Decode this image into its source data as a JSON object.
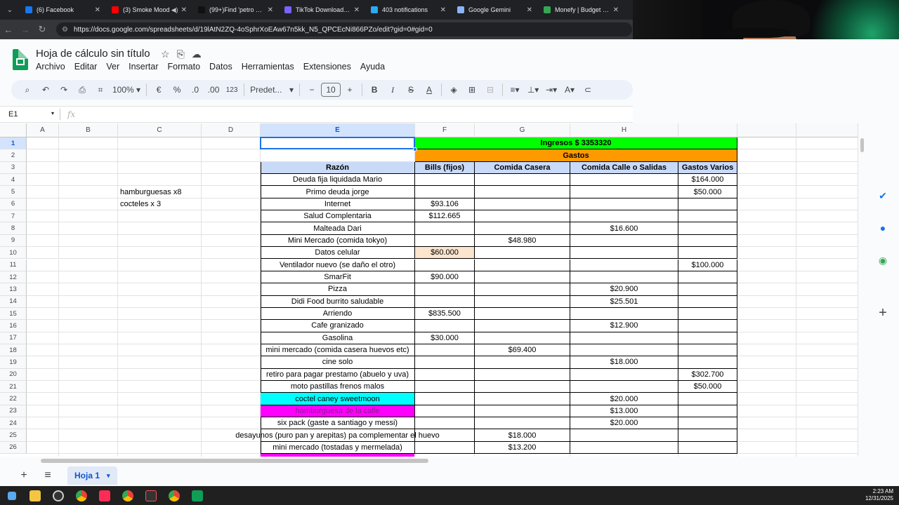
{
  "browser": {
    "tabs": [
      {
        "title": "(6) Facebook",
        "color": "#1877f2",
        "sound": false
      },
      {
        "title": "(3) Smoke Mood",
        "color": "#ff0000",
        "sound": true
      },
      {
        "title": "(99+)Find 'petro anu",
        "color": "#111111",
        "sound": false
      },
      {
        "title": "TikTok Downloader -",
        "color": "#7b61ff",
        "sound": false
      },
      {
        "title": "403 notifications",
        "color": "#2aabee",
        "sound": false
      },
      {
        "title": "Google Gemini",
        "color": "#8ab4f8",
        "sound": false
      },
      {
        "title": "Monefy | Budget & Tr",
        "color": "#34a853",
        "sound": false
      }
    ],
    "url": "https://docs.google.com/spreadsheets/d/19lAtN2ZQ-4oSphrXoEAw67n5kk_N5_QPCEcNi866PZo/edit?gid=0#gid=0"
  },
  "doc": {
    "title": "Hoja de cálculo sin título",
    "menus": [
      "Archivo",
      "Editar",
      "Ver",
      "Insertar",
      "Formato",
      "Datos",
      "Herramientas",
      "Extensiones",
      "Ayuda"
    ]
  },
  "toolbar": {
    "zoom": "100%",
    "currency": "€",
    "percent": "%",
    "dec_less": ".0",
    "dec_more": ".00",
    "number_format": "123",
    "font": "Predet...",
    "font_size": "10"
  },
  "formula_bar": {
    "cell_ref": "E1",
    "fx": "fx"
  },
  "columns": [
    "A",
    "B",
    "C",
    "D",
    "E",
    "F",
    "G",
    "H"
  ],
  "selected_column": "E",
  "selected_row": "1",
  "rows": [
    "1",
    "2",
    "3",
    "4",
    "5",
    "6",
    "7",
    "8",
    "9",
    "10",
    "11",
    "12",
    "13",
    "14",
    "15",
    "16",
    "17",
    "18",
    "19",
    "20",
    "21",
    "22",
    "23",
    "24",
    "25",
    "26"
  ],
  "sheet": {
    "ingresos": "Ingresos $ 3353320",
    "gastos": "Gastos",
    "headers": {
      "E": "Razón",
      "F": "Bills (fijos)",
      "G": "Comida Casera",
      "H": "Comida Calle o Salidas",
      "I": "Gastos Varios"
    },
    "notes": {
      "C5": "hamburguesas x8",
      "C6": "cocteles x 3"
    },
    "data_rows": [
      {
        "row": 4,
        "E": "Deuda fija liquidada Mario",
        "F": "",
        "G": "",
        "H": "",
        "I": "$164.000"
      },
      {
        "row": 5,
        "E": "Primo deuda jorge",
        "F": "",
        "G": "",
        "H": "",
        "I": "$50.000"
      },
      {
        "row": 6,
        "E": "Internet",
        "F": "$93.106",
        "G": "",
        "H": "",
        "I": ""
      },
      {
        "row": 7,
        "E": "Salud Complentaria",
        "F": "$112.665",
        "G": "",
        "H": "",
        "I": ""
      },
      {
        "row": 8,
        "E": "Malteada Dari",
        "F": "",
        "G": "",
        "H": "$16.600",
        "I": ""
      },
      {
        "row": 9,
        "E": "Mini Mercado (comida tokyo)",
        "F": "",
        "G": "$48.980",
        "H": "",
        "I": ""
      },
      {
        "row": 10,
        "E": "Datos celular",
        "F": "$60.000",
        "G": "",
        "H": "",
        "I": ""
      },
      {
        "row": 11,
        "E": "Ventilador nuevo (se daño el otro)",
        "F": "",
        "G": "",
        "H": "",
        "I": "$100.000"
      },
      {
        "row": 12,
        "E": "SmarFit",
        "F": "$90.000",
        "G": "",
        "H": "",
        "I": ""
      },
      {
        "row": 13,
        "E": "Pizza",
        "F": "",
        "G": "",
        "H": "$20.900",
        "I": ""
      },
      {
        "row": 14,
        "E": "Didi Food burrito saludable",
        "F": "",
        "G": "",
        "H": "$25.501",
        "I": ""
      },
      {
        "row": 15,
        "E": "Arriendo",
        "F": "$835.500",
        "G": "",
        "H": "",
        "I": ""
      },
      {
        "row": 16,
        "E": "Cafe granizado",
        "F": "",
        "G": "",
        "H": "$12.900",
        "I": ""
      },
      {
        "row": 17,
        "E": "Gasolina",
        "F": "$30.000",
        "G": "",
        "H": "",
        "I": ""
      },
      {
        "row": 18,
        "E": "mini mercado (comida casera huevos etc)",
        "F": "",
        "G": "$69.400",
        "H": "",
        "I": ""
      },
      {
        "row": 19,
        "E": "cine solo",
        "F": "",
        "G": "",
        "H": "$18.000",
        "I": ""
      },
      {
        "row": 20,
        "E": "retiro para pagar prestamo (abuelo y uva)",
        "F": "",
        "G": "",
        "H": "",
        "I": "$302.700"
      },
      {
        "row": 21,
        "E": "moto pastillas frenos malos",
        "F": "",
        "G": "",
        "H": "",
        "I": "$50.000"
      },
      {
        "row": 22,
        "E": "coctel caney sweetmoon",
        "F": "",
        "G": "",
        "H": "$20.000",
        "I": ""
      },
      {
        "row": 23,
        "E": "hamburguesa de la calle",
        "F": "",
        "G": "",
        "H": "$13.000",
        "I": ""
      },
      {
        "row": 24,
        "E": "six pack (gaste a santiago y messi)",
        "F": "",
        "G": "",
        "H": "$20.000",
        "I": ""
      },
      {
        "row": 25,
        "E": "desayunos (puro pan y arepitas) pa complementar el huevo",
        "F": "",
        "G": "$18.000",
        "H": "",
        "I": ""
      },
      {
        "row": 26,
        "E": "mini mercado (tostadas y mermelada)",
        "F": "",
        "G": "$13.200",
        "H": "",
        "I": ""
      }
    ],
    "colors": {
      "ingresos_bg": "#00ff00",
      "gastos_bg": "#ff9900",
      "header_bg": "#c9daf8",
      "cyan": "#00ffff",
      "magenta": "#ff00ff",
      "peach": "#fce5cd"
    }
  },
  "sheet_tab": "Hoja 1",
  "clock": {
    "time": "2:23 AM",
    "date": "12/31/2025"
  }
}
